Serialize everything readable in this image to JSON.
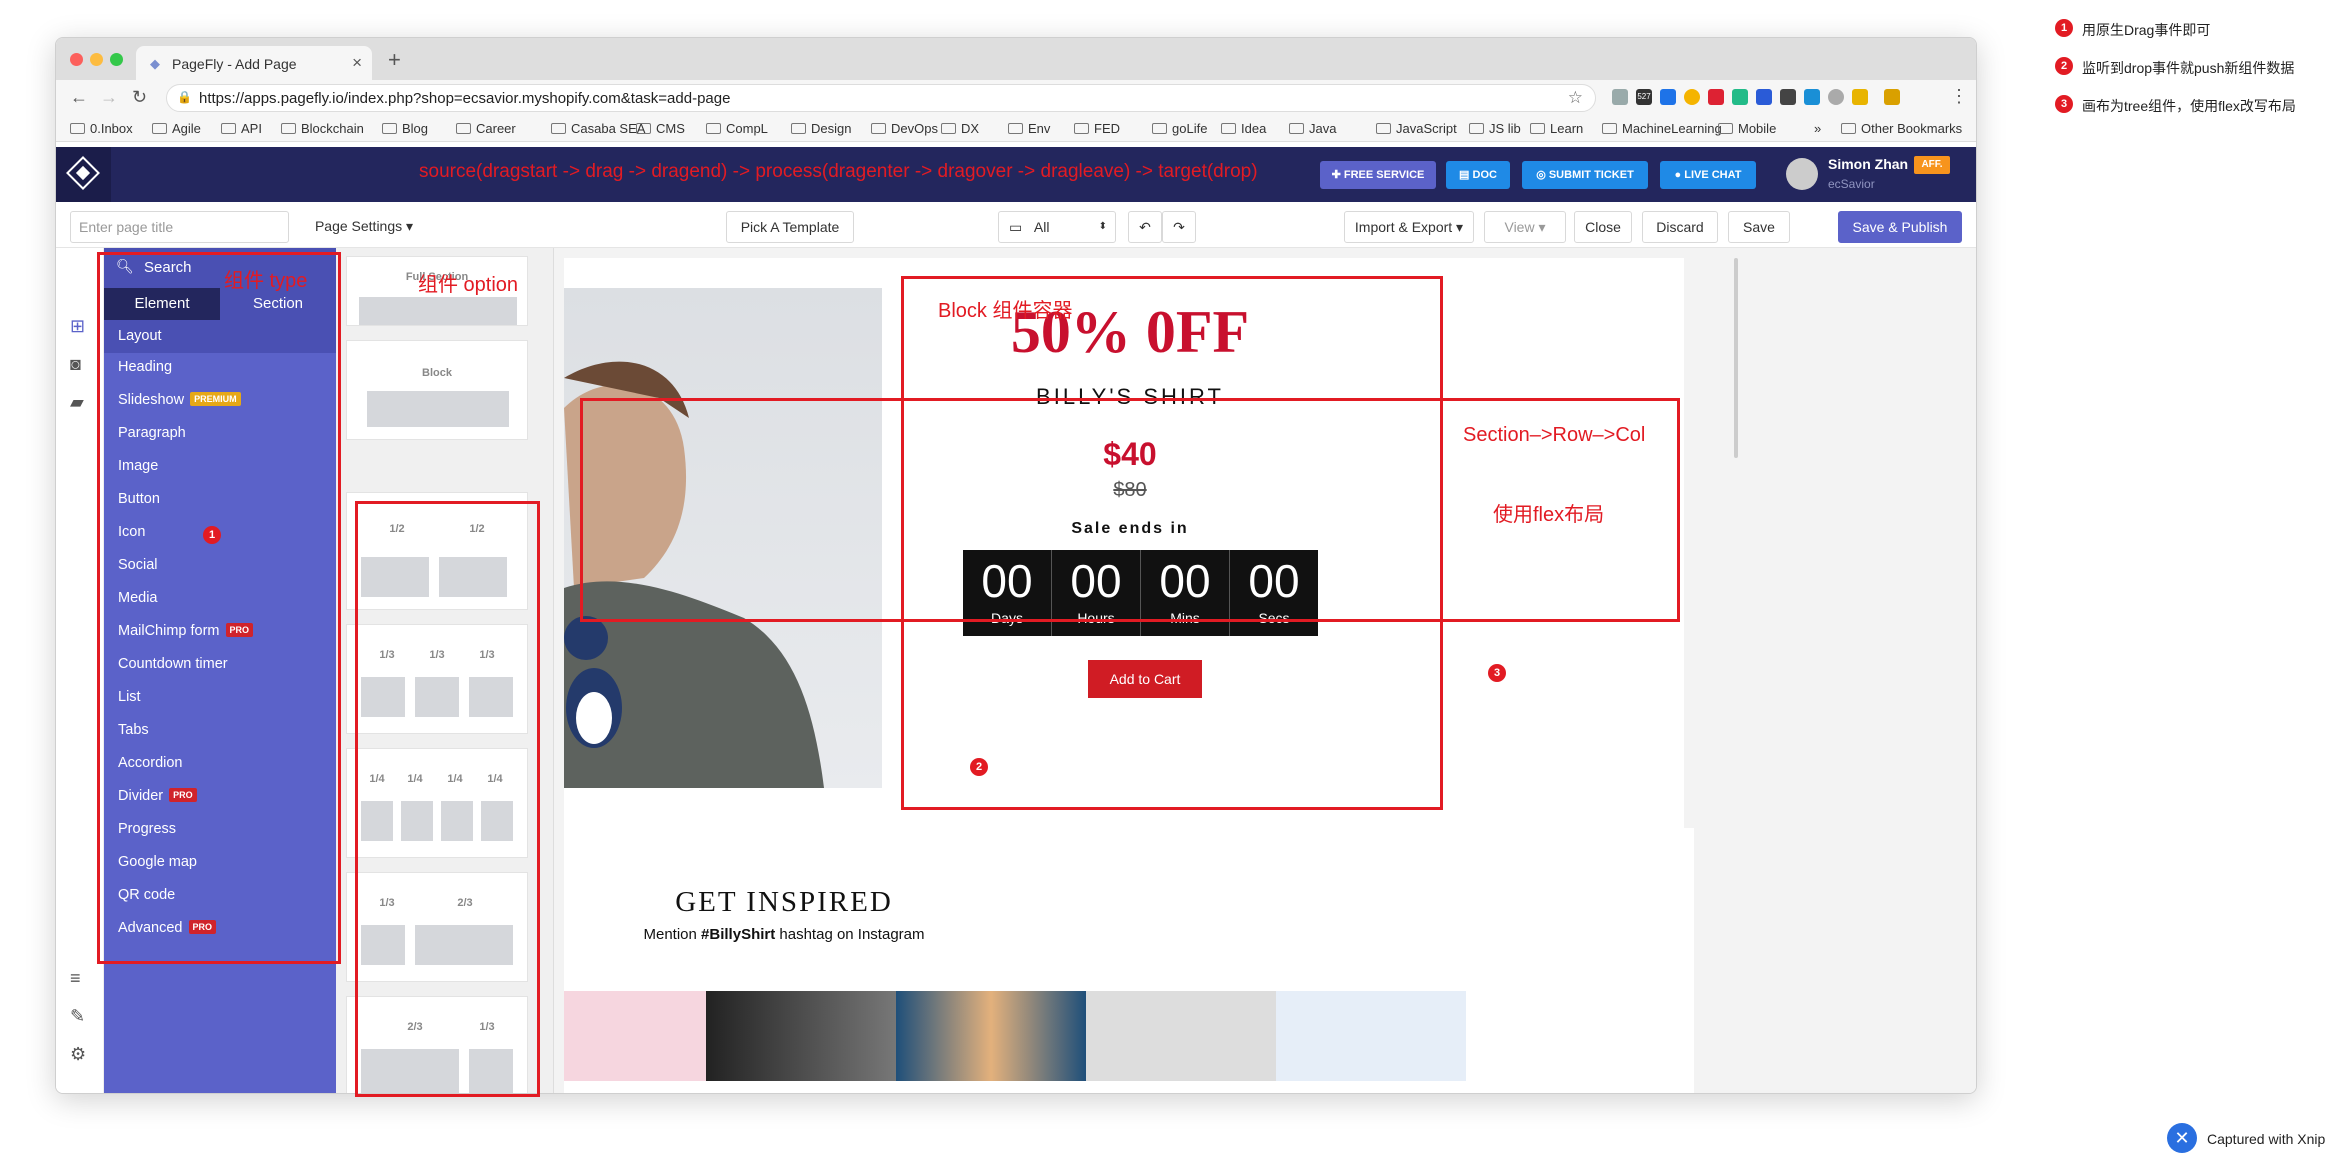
{
  "browser": {
    "tab_title": "PageFly - Add Page",
    "url": "https://apps.pagefly.io/index.php?shop=ecsavior.myshopify.com&task=add-page",
    "ext_badge": "527",
    "bookmarks": [
      "0.Inbox",
      "Agile",
      "API",
      "Blockchain",
      "Blog",
      "Career",
      "Casaba SEA",
      "CMS",
      "CompL",
      "Design",
      "DevOps",
      "DX",
      "Env",
      "FED",
      "goLife",
      "Idea",
      "Java",
      "JavaScript",
      "JS lib",
      "Learn",
      "MachineLearning",
      "Mobile"
    ],
    "bookmarks_more": "»",
    "other_bookmarks": "Other Bookmarks"
  },
  "header": {
    "flow_text": "source(dragstart -> drag -> dragend) -> process(dragenter -> dragover -> dragleave) -> target(drop)",
    "free_service": "FREE SERVICE",
    "doc": "DOC",
    "submit_ticket": "SUBMIT TICKET",
    "live_chat": "LIVE CHAT",
    "user_name": "Simon Zhan",
    "user_shop": "ecSavior",
    "aff": "AFF."
  },
  "toolbar": {
    "page_title_placeholder": "Enter page title",
    "page_settings": "Page Settings",
    "pick_template": "Pick A Template",
    "device": "All",
    "import_export": "Import & Export",
    "view": "View",
    "close": "Close",
    "discard": "Discard",
    "save": "Save",
    "save_publish": "Save & Publish"
  },
  "panel": {
    "search": "Search",
    "tab_element": "Element",
    "tab_section": "Section",
    "items": [
      {
        "label": "Layout",
        "badge": ""
      },
      {
        "label": "Heading",
        "badge": ""
      },
      {
        "label": "Slideshow",
        "badge": "PREMIUM"
      },
      {
        "label": "Paragraph",
        "badge": ""
      },
      {
        "label": "Image",
        "badge": ""
      },
      {
        "label": "Button",
        "badge": ""
      },
      {
        "label": "Icon",
        "badge": ""
      },
      {
        "label": "Social",
        "badge": ""
      },
      {
        "label": "Media",
        "badge": ""
      },
      {
        "label": "MailChimp form",
        "badge": "PRO"
      },
      {
        "label": "Countdown timer",
        "badge": ""
      },
      {
        "label": "List",
        "badge": ""
      },
      {
        "label": "Tabs",
        "badge": ""
      },
      {
        "label": "Accordion",
        "badge": ""
      },
      {
        "label": "Divider",
        "badge": "PRO"
      },
      {
        "label": "Progress",
        "badge": ""
      },
      {
        "label": "Google map",
        "badge": ""
      },
      {
        "label": "QR code",
        "badge": ""
      },
      {
        "label": "Advanced",
        "badge": "PRO"
      }
    ]
  },
  "options": {
    "full_section": "Full Section",
    "block": "Block",
    "half": "1/2",
    "third": "1/3",
    "quarter": "1/4",
    "two_thirds": "2/3"
  },
  "product": {
    "sale": "50% 0FF",
    "name": "BILLY'S SHIRT",
    "price": "$40",
    "old_price": "$80",
    "sale_ends": "Sale ends in",
    "countdown": [
      {
        "value": "00",
        "unit": "Days"
      },
      {
        "value": "00",
        "unit": "Hours"
      },
      {
        "value": "00",
        "unit": "Mins"
      },
      {
        "value": "00",
        "unit": "Secs"
      }
    ],
    "add_to_cart": "Add to Cart"
  },
  "inspired": {
    "title": "GET INSPIRED",
    "sub_pre": "Mention ",
    "sub_tag": "#BillyShirt",
    "sub_post": " hashtag on Instagram"
  },
  "annotations": {
    "type_label": "组件 type",
    "option_label": "组件 option",
    "block_label": "Block 组件容器",
    "section_label": "Section–>Row–>Col",
    "flex_label": "使用flex布局",
    "n1": "1",
    "n2": "2",
    "n3": "3"
  },
  "notes": [
    {
      "num": "1",
      "text": "用原生Drag事件即可"
    },
    {
      "num": "2",
      "text": "监听到drop事件就push新组件数据"
    },
    {
      "num": "3",
      "text": "画布为tree组件，使用flex改写布局"
    }
  ],
  "capture": "Captured with Xnip",
  "colors": {
    "accent": "#5b62c9",
    "header": "#23265d",
    "annotation": "#e21b23",
    "primary_btn": "#5b62c9"
  }
}
